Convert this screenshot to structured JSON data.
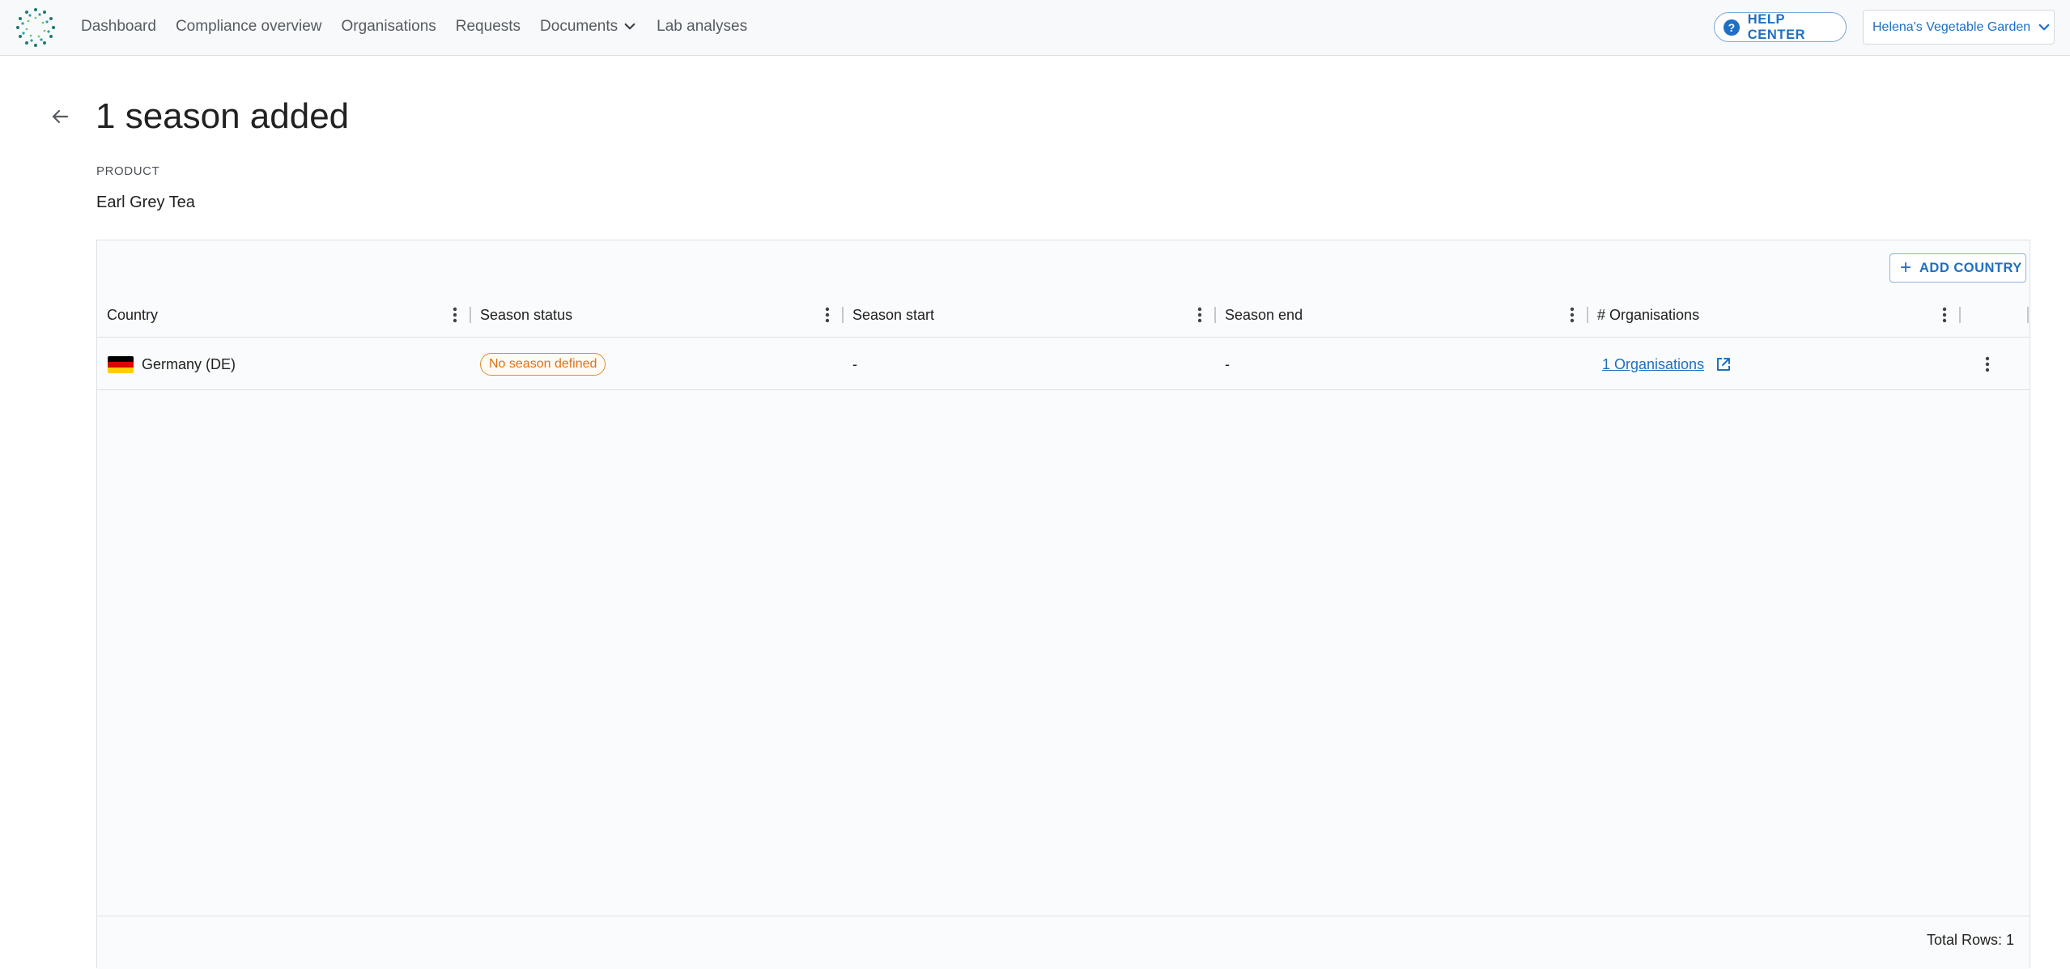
{
  "nav": {
    "items": [
      {
        "label": "Dashboard",
        "name": "nav-dashboard"
      },
      {
        "label": "Compliance overview",
        "name": "nav-compliance-overview"
      },
      {
        "label": "Organisations",
        "name": "nav-organisations"
      },
      {
        "label": "Requests",
        "name": "nav-requests"
      },
      {
        "label": "Documents",
        "name": "nav-documents"
      },
      {
        "label": "Lab analyses",
        "name": "nav-lab-analyses"
      }
    ],
    "help_label": "HELP CENTER",
    "org_selected": "Helena's Vegetable Garden"
  },
  "page": {
    "title": "1 season added",
    "product_label": "PRODUCT",
    "product_value": "Earl Grey Tea"
  },
  "grid": {
    "add_button": "ADD COUNTRY",
    "columns": [
      "Country",
      "Season status",
      "Season start",
      "Season end",
      "# Organisations"
    ],
    "rows": [
      {
        "country": "Germany (DE)",
        "flag_colors": [
          "#000000",
          "#dd0000",
          "#ffce00"
        ],
        "season_status": "No season defined",
        "season_start": "-",
        "season_end": "-",
        "organisations": "1 Organisations"
      }
    ],
    "total_rows": "Total Rows: 1"
  },
  "colors": {
    "accent": "#1f6fc2",
    "status_warning": "#d9731a"
  }
}
